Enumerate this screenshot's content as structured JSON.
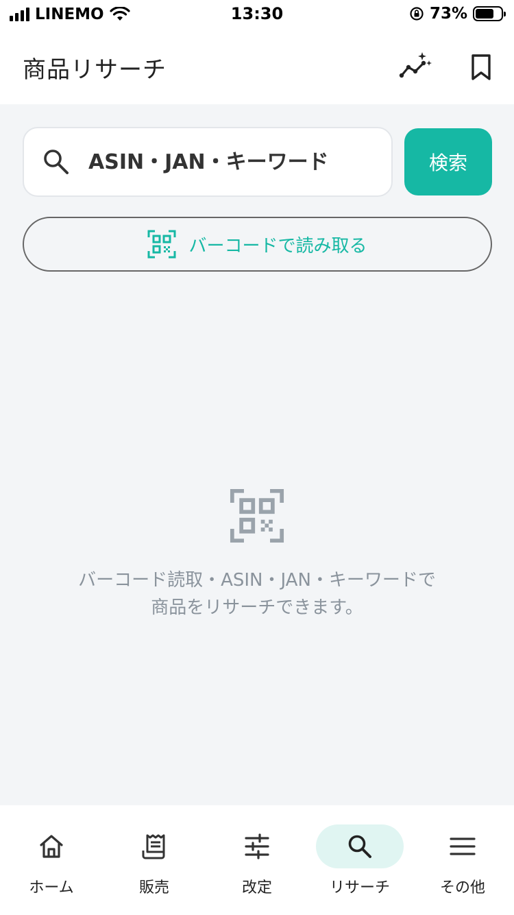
{
  "status_bar": {
    "carrier": "LINEMO",
    "time": "13:30",
    "battery_percent": "73%",
    "battery_level": 0.73
  },
  "header": {
    "title": "商品リサーチ"
  },
  "search": {
    "placeholder": "ASIN・JAN・キーワード",
    "button_label": "検索"
  },
  "barcode_button": {
    "label": "バーコードで読み取る"
  },
  "empty_state": {
    "line1": "バーコード読取・ASIN・JAN・キーワードで",
    "line2": "商品をリサーチできます。"
  },
  "bottom_nav": {
    "items": [
      {
        "label": "ホーム",
        "icon": "home-icon"
      },
      {
        "label": "販売",
        "icon": "receipt-icon"
      },
      {
        "label": "改定",
        "icon": "sliders-icon"
      },
      {
        "label": "リサーチ",
        "icon": "search-icon",
        "active": true
      },
      {
        "label": "その他",
        "icon": "menu-icon"
      }
    ]
  },
  "colors": {
    "accent": "#16b8a4",
    "background": "#f3f5f7",
    "muted_text": "#8a939c",
    "active_pill": "#e0f5f2"
  }
}
